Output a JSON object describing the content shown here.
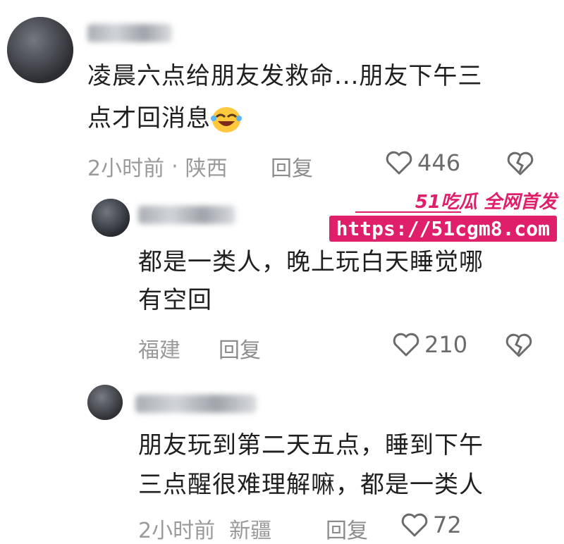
{
  "comments": [
    {
      "text_line1": "凌晨六点给朋友发救命...朋友下午三",
      "text_line2": "点才回消息",
      "emoji": "laughing-crying-emoji",
      "meta_time": "2小时前",
      "meta_sep": "·",
      "meta_location": "陕西",
      "reply_label": "回复",
      "likes": "446"
    },
    {
      "text_line1": "都是一类人，晚上玩白天睡觉哪",
      "text_line2": "有空回",
      "meta_location": "福建",
      "reply_label": "回复",
      "likes": "210"
    },
    {
      "text_line1": "朋友玩到第二天五点，睡到下午",
      "text_line2": "三点醒很难理解嘛，都是一类人",
      "meta_time": "2小时前",
      "meta_location": "新疆",
      "reply_label": "回复",
      "likes": "72"
    }
  ],
  "watermark": {
    "brand": "51吃瓜 全网首发",
    "url": "https://51cgm8.com"
  },
  "icons": {
    "heart": "heart-outline-icon",
    "broken_heart": "broken-heart-icon"
  },
  "colors": {
    "watermark": "#e01f6a",
    "meta_text": "#9a9a9a",
    "body_text": "#1f1f1f"
  }
}
